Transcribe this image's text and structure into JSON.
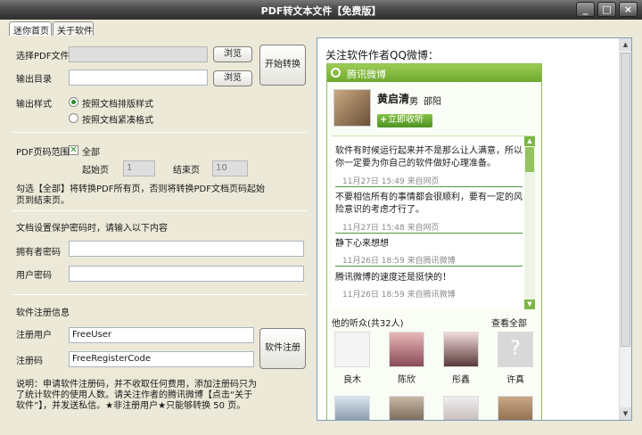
{
  "window": {
    "title": "PDF转文本文件【免费版】"
  },
  "tabs": [
    {
      "label": "迷你首页"
    },
    {
      "label": "关于软件"
    }
  ],
  "form": {
    "select_pdf_label": "选择PDF文件",
    "output_dir_label": "输出目录",
    "browse1_label": "浏览",
    "browse2_label": "浏览",
    "start_button": "开始转换",
    "output_style_label": "输出样式",
    "style_option1": "按照文档排版样式",
    "style_option2": "按照文档紧凑格式",
    "page_range_label": "PDF页码范围",
    "all_label": "全部",
    "start_page_label": "起始页",
    "start_page_value": "1",
    "end_page_label": "结束页",
    "end_page_value": "10",
    "range_note": "勾选【全部】将转换PDF所有页，否则将转换PDF文档页码起始页到结束页。",
    "password_note": "文档设置保护密码时，请输入以下内容",
    "owner_pwd_label": "拥有者密码",
    "user_pwd_label": "用户密码",
    "reg_info_label": "软件注册信息",
    "reg_user_label": "注册用户",
    "reg_user_value": "FreeUser",
    "reg_code_label": "注册码",
    "reg_code_value": "FreeRegisterCode",
    "reg_button": "软件注册",
    "footer_note": "说明：申请软件注册码，并不收取任何费用，添加注册码只为了统计软件的使用人数。请关注作者的腾讯微博【点击“关于软件”】，并发送私信。★非注册用户★只能够转换 50 页。"
  },
  "right": {
    "heading": "关注软件作者QQ微博：",
    "widget_title": "腾讯微博",
    "profile": {
      "name": "黄启清",
      "gender": "男",
      "city": "邵阳",
      "follow": "立即收听"
    },
    "feed": [
      {
        "text": "软件有时候运行起来并不是那么让人满意，所以你一定要为你自己的软件做好心理准备。",
        "meta": "11月27日 15:49 来自网页"
      },
      {
        "text": "不要相信所有的事情都会很顺利，要有一定的风险意识的考虑才行了。",
        "meta": "11月27日 15:48 来自网页"
      },
      {
        "text": "静下心来想想",
        "meta": "11月26日 18:59 来自腾讯微博"
      },
      {
        "text": "腾讯微博的速度还是挺快的！",
        "meta": "11月26日 18:59 来自腾讯微博"
      }
    ],
    "fans_title": "他的听众(共32人)",
    "fans_all": "查看全部",
    "fans": [
      {
        "name": "良木"
      },
      {
        "name": "陈欣"
      },
      {
        "name": "彤鑫"
      },
      {
        "name": "许真"
      }
    ]
  },
  "colors": {
    "accent_green": "#6ea82e",
    "titlebar": "#3a3a3a"
  }
}
